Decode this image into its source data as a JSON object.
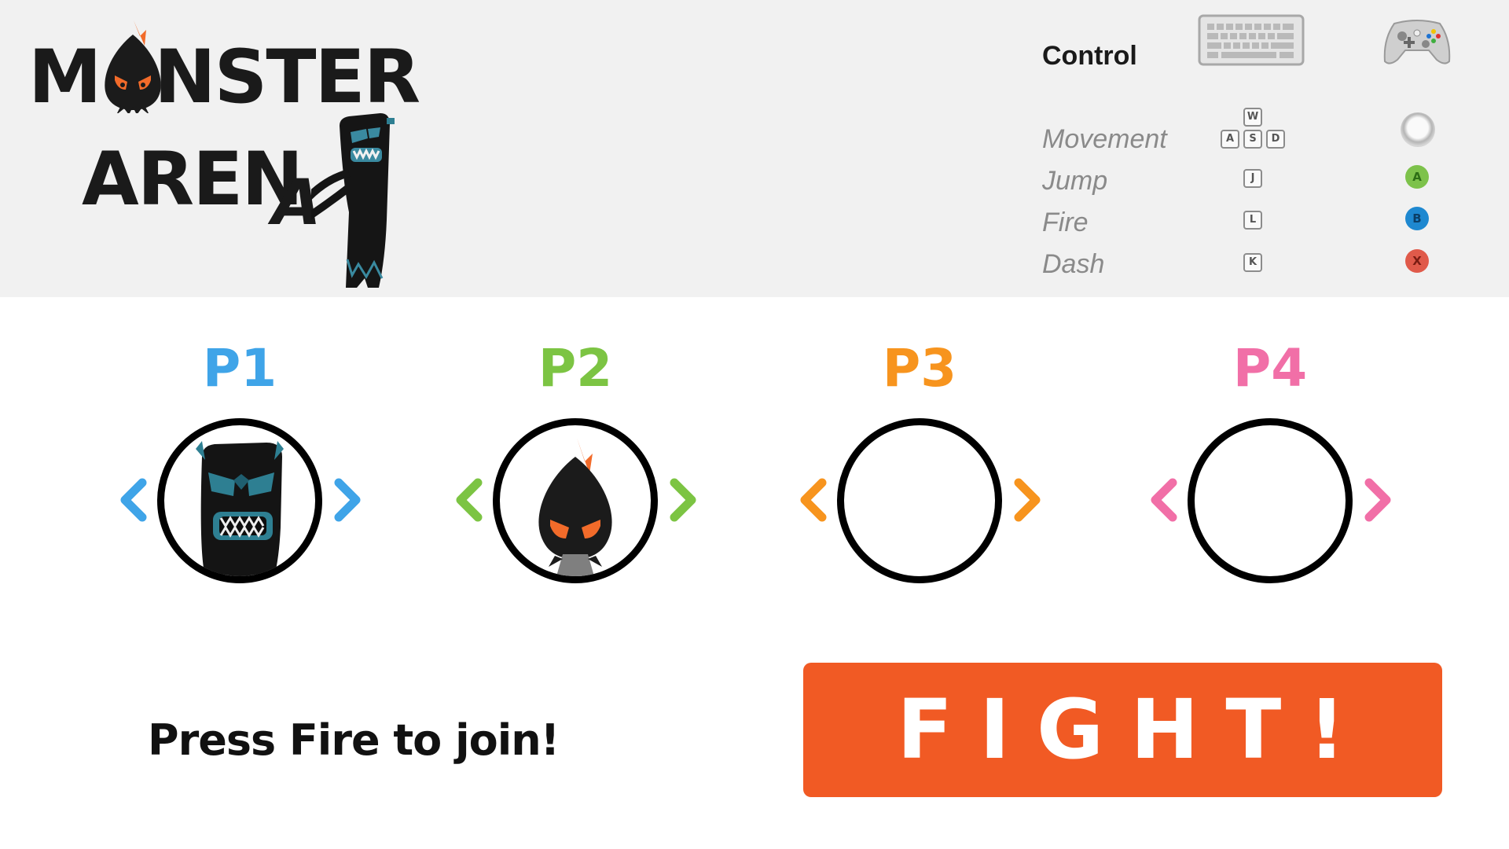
{
  "logo": {
    "line1_a": "M",
    "line1_b": "NSTER",
    "line2_a": "AREN",
    "line2_b": "A"
  },
  "controls": {
    "title": "Control",
    "rows": [
      {
        "label": "Movement"
      },
      {
        "label": "Jump",
        "key": "J",
        "button": "A",
        "button_color": "#7dc24b"
      },
      {
        "label": "Fire",
        "key": "L",
        "button": "B",
        "button_color": "#1e88d0"
      },
      {
        "label": "Dash",
        "key": "K",
        "button": "X",
        "button_color": "#e05a4a"
      }
    ],
    "movement_keys": {
      "up": "W",
      "left": "A",
      "down": "S",
      "right": "D"
    }
  },
  "players": [
    {
      "label": "P1",
      "color": "#3fa4e8",
      "monster": "tall-blue-monster"
    },
    {
      "label": "P2",
      "color": "#7cc443",
      "monster": "flame-monster"
    },
    {
      "label": "P3",
      "color": "#f7941e",
      "monster": ""
    },
    {
      "label": "P4",
      "color": "#f16fa7",
      "monster": ""
    }
  ],
  "join_prompt": "Press Fire to join!",
  "fight_button": "FIGHT!",
  "accent_color": "#f15a24"
}
